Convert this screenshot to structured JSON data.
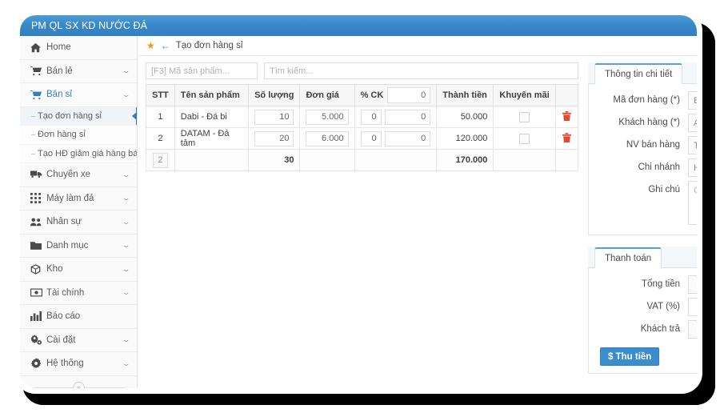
{
  "window": {
    "title": "PM QL SX KD NƯỚC ĐÁ",
    "title_bar_color": "#3887c8"
  },
  "sidebar": {
    "items": [
      {
        "label": "Home",
        "icon": "home-icon",
        "glyph": "⌂",
        "caret": "",
        "active": false
      },
      {
        "label": "Bán lẻ",
        "icon": "cart-icon",
        "glyph": "🛒",
        "caret": "⌄",
        "active": false
      },
      {
        "label": "Bán sỉ",
        "icon": "cart-icon",
        "glyph": "🛒",
        "caret": "⌄",
        "active": true
      },
      {
        "label": "Chuyến xe",
        "icon": "truck-icon",
        "glyph": "🚚",
        "caret": "⌄",
        "active": false
      },
      {
        "label": "Máy làm đá",
        "icon": "grid-icon",
        "glyph": "▦",
        "caret": "⌄",
        "active": false
      },
      {
        "label": "Nhân sự",
        "icon": "users-icon",
        "glyph": "👥",
        "caret": "⌄",
        "active": false
      },
      {
        "label": "Danh mục",
        "icon": "folder-icon",
        "glyph": "📁",
        "caret": "⌄",
        "active": false
      },
      {
        "label": "Kho",
        "icon": "box-icon",
        "glyph": "📦",
        "caret": "⌄",
        "active": false
      },
      {
        "label": "Tài chính",
        "icon": "money-icon",
        "glyph": "💵",
        "caret": "⌄",
        "active": false
      },
      {
        "label": "Báo cáo",
        "icon": "chart-bar-icon",
        "glyph": "📊",
        "caret": "",
        "active": false
      },
      {
        "label": "Cài đặt",
        "icon": "gears-icon",
        "glyph": "⚙",
        "caret": "⌄",
        "active": false
      },
      {
        "label": "Hệ thống",
        "icon": "gear-icon",
        "glyph": "⚙",
        "caret": "⌄",
        "active": false
      }
    ],
    "submenu": [
      {
        "label": "Tạo đơn hàng sỉ",
        "selected": true
      },
      {
        "label": "Đơn hàng sỉ",
        "selected": false
      },
      {
        "label": "Tạo HĐ giảm giá hàng bán",
        "selected": false
      }
    ],
    "collapse_glyph": "«"
  },
  "breadcrumb": {
    "star_glyph": "★",
    "back_glyph": "←",
    "title": "Tạo đơn hàng sỉ"
  },
  "search": {
    "code_placeholder": "[F3] Mã sản phẩm...",
    "find_placeholder": "Tìm kiếm..."
  },
  "table": {
    "headers": {
      "stt": "STT",
      "name": "Tên sản phẩm",
      "qty": "Số lượng",
      "price": "Đơn giá",
      "ck": "% CK",
      "ck_value": "0",
      "total": "Thành tiền",
      "promo": "Khuyến mãi"
    },
    "rows": [
      {
        "stt": "1",
        "name": "Dabi - Đá bi",
        "qty": "10",
        "price": "5.000",
        "ck_pct": "0",
        "ck_amt": "0",
        "total": "50.000",
        "delete_glyph": "🗑"
      },
      {
        "stt": "2",
        "name": "DATAM - Đá tảm",
        "qty": "20",
        "price": "6.000",
        "ck_pct": "0",
        "ck_amt": "0",
        "total": "120.000",
        "delete_glyph": "🗑"
      }
    ],
    "footer": {
      "count": "2",
      "qty_total": "30",
      "grand_total": "170.000"
    }
  },
  "detail_panel": {
    "tab_label": "Thông tin chi tiết",
    "fields": [
      {
        "label": "Mã đơn hàng (*)",
        "value": "BHHC"
      },
      {
        "label": "Khách hàng (*)",
        "value": "Anh L"
      },
      {
        "label": "NV bán hàng",
        "value": "Tui là"
      },
      {
        "label": "Chi nhánh",
        "value": "HCM"
      }
    ],
    "note_label": "Ghi chú",
    "note_placeholder": "Ghi c"
  },
  "payment_panel": {
    "tab_label": "Thanh toán",
    "fields": [
      {
        "label": "Tổng tiền",
        "value": ""
      },
      {
        "label": "VAT (%)",
        "value": ""
      },
      {
        "label": "Khách trả",
        "value": ""
      }
    ],
    "button_label": "$ Thu tiền",
    "button_color": "#3c8dcd"
  }
}
